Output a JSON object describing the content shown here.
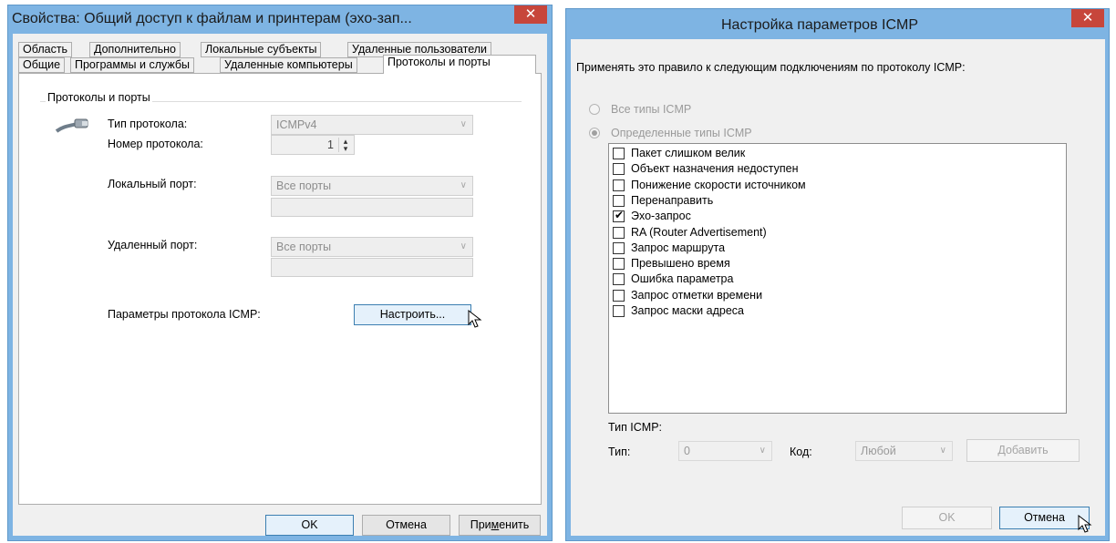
{
  "left_dialog": {
    "title": "Свойства: Общий доступ к файлам и принтерам (эхо-зап...",
    "close_glyph": "✕",
    "tabs_row1": [
      "Область",
      "Дополнительно",
      "Локальные субъекты",
      "Удаленные пользователи"
    ],
    "tabs_row2": [
      "Общие",
      "Программы и службы",
      "Удаленные компьютеры",
      "Протоколы и порты"
    ],
    "group_title": "Протоколы и порты",
    "protocol_type_label": "Тип протокола:",
    "protocol_type_value": "ICMPv4",
    "protocol_number_label": "Номер протокола:",
    "protocol_number_value": "1",
    "local_port_label": "Локальный порт:",
    "local_port_value": "Все порты",
    "remote_port_label": "Удаленный порт:",
    "remote_port_value": "Все порты",
    "icmp_params_label": "Параметры протокола ICMP:",
    "customize_button": "Настроить...",
    "ok_button": "OK",
    "cancel_button": "Отмена",
    "apply_button_pre": "При",
    "apply_button_u": "м",
    "apply_button_post": "енить"
  },
  "right_dialog": {
    "title": "Настройка параметров ICMP",
    "close_glyph": "✕",
    "apply_rule_text": "Применять это правило к следующим подключениям по протоколу ICMP:",
    "all_types_label": "Все типы ICMP",
    "specific_types_label": "Определенные типы ICMP",
    "icmp_types": [
      {
        "label": "Пакет слишком велик",
        "checked": false
      },
      {
        "label": "Объект назначения недоступен",
        "checked": false
      },
      {
        "label": "Понижение скорости источником",
        "checked": false
      },
      {
        "label": "Перенаправить",
        "checked": false
      },
      {
        "label": "Эхо-запрос",
        "checked": true
      },
      {
        "label": "RA (Router Advertisement)",
        "checked": false
      },
      {
        "label": "Запрос маршрута",
        "checked": false
      },
      {
        "label": "Превышено время",
        "checked": false
      },
      {
        "label": "Ошибка параметра",
        "checked": false
      },
      {
        "label": "Запрос отметки времени",
        "checked": false
      },
      {
        "label": "Запрос маски адреса",
        "checked": false
      }
    ],
    "icmp_type_section_label": "Тип ICMP:",
    "type_label": "Тип:",
    "type_value": "0",
    "code_label": "Код:",
    "code_value": "Любой",
    "add_button": "Добавить",
    "ok_button": "OK",
    "cancel_button": "Отмена"
  },
  "colors": {
    "title_bar": "#7eb4e3",
    "close_button": "#c7463b",
    "dialog_background": "#f0f0f0"
  },
  "icons": {
    "protocol": "network-cable-icon",
    "combo_arrow": "chevron-down-icon",
    "spinner": "spinner-arrows-icon",
    "check": "checkmark-icon",
    "cursor": "mouse-pointer-icon"
  }
}
